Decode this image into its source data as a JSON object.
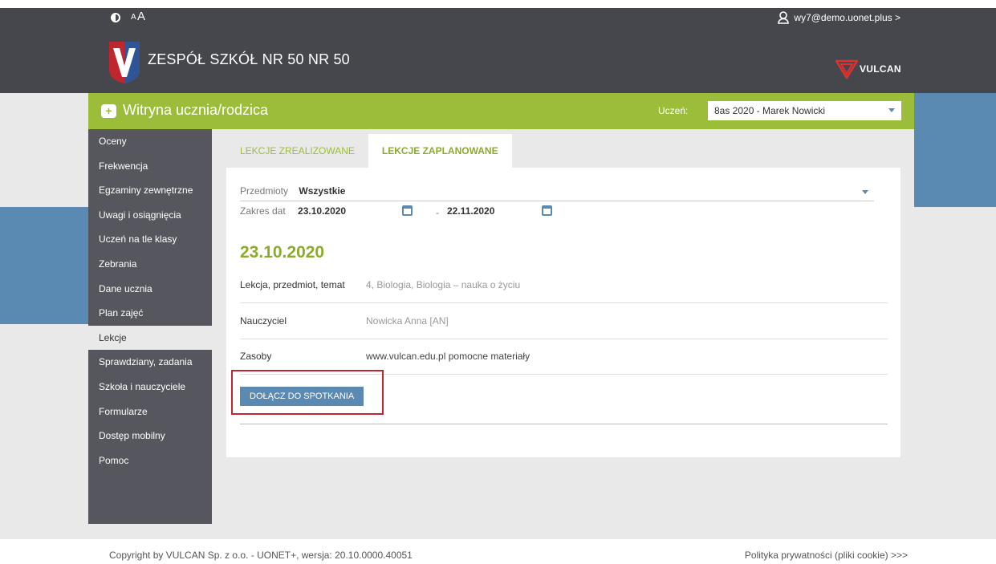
{
  "header": {
    "font_small": "A",
    "font_large": "A",
    "user": "wy7@demo.uonet.plus >",
    "school_name": "ZESPÓŁ SZKÓŁ NR 50 NR 50",
    "brand": "VULCAN"
  },
  "appbar": {
    "title": "Witryna ucznia/rodzica",
    "student_label": "Uczeń:",
    "student_value": "8as 2020 - Marek Nowicki"
  },
  "sidebar": {
    "items": [
      {
        "label": "Oceny"
      },
      {
        "label": "Frekwencja"
      },
      {
        "label": "Egzaminy zewnętrzne"
      },
      {
        "label": "Uwagi i osiągnięcia"
      },
      {
        "label": "Uczeń na tle klasy"
      },
      {
        "label": "Zebrania"
      },
      {
        "label": "Dane ucznia"
      },
      {
        "label": "Plan zajęć"
      },
      {
        "label": "Lekcje"
      },
      {
        "label": "Sprawdziany, zadania"
      },
      {
        "label": "Szkoła i nauczyciele"
      },
      {
        "label": "Formularze"
      },
      {
        "label": "Dostęp mobilny"
      },
      {
        "label": "Pomoc"
      }
    ],
    "active_index": 8
  },
  "tabs": {
    "completed": "LEKCJE ZREALIZOWANE",
    "planned": "LEKCJE ZAPLANOWANE"
  },
  "filters": {
    "subjects_label": "Przedmioty",
    "subjects_value": "Wszystkie",
    "range_label": "Zakres dat",
    "date_from": "23.10.2020",
    "separator": "-",
    "date_to": "22.11.2020"
  },
  "lesson": {
    "date": "23.10.2020",
    "rows": [
      {
        "label": "Lekcja, przedmiot, temat",
        "value": "4, Biologia, Biologia – nauka o życiu"
      },
      {
        "label": "Nauczyciel",
        "value": "Nowicka Anna [AN]"
      },
      {
        "label": "Zasoby",
        "value": "www.vulcan.edu.pl pomocne materiały"
      }
    ],
    "join_button": "DOŁĄCZ DO SPOTKANIA"
  },
  "footer": {
    "copyright": "Copyright by VULCAN Sp. z o.o. - UONET+, wersja: 20.10.0000.40051",
    "privacy": "Polityka prywatności (pliki cookie) >>>"
  },
  "colors": {
    "header_bg": "#46474d",
    "green": "#9cbd3a",
    "blue": "#5a89b1",
    "highlight_red": "#c0262d"
  }
}
